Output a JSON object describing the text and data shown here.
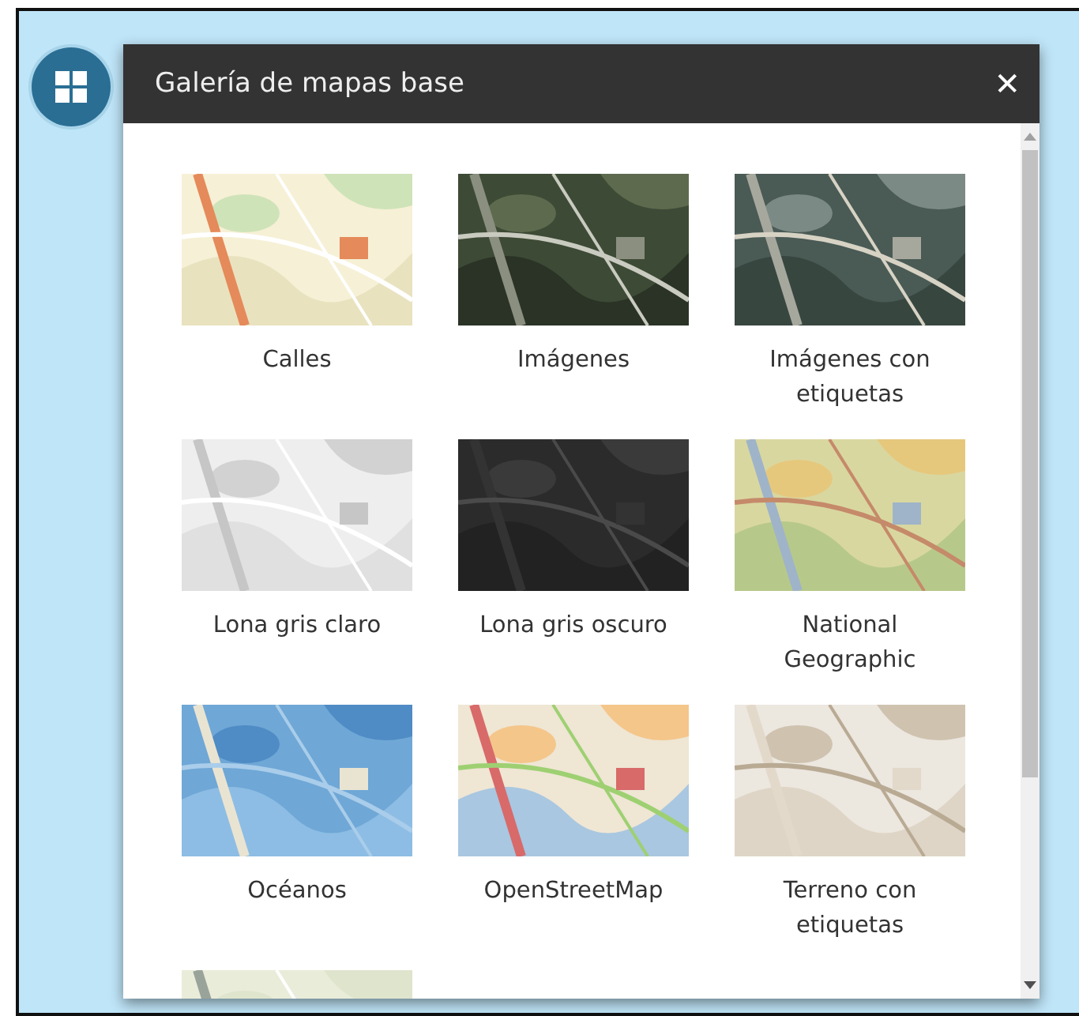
{
  "panel": {
    "title": "Galería de mapas base",
    "close": "✕"
  },
  "basemaps": [
    {
      "label": "Calles",
      "kind": "picture"
    },
    {
      "label": "Imágenes",
      "kind": "picture"
    },
    {
      "label": "Imágenes con etiquetas",
      "kind": "picture"
    },
    {
      "label": "Lona gris claro",
      "kind": "picture"
    },
    {
      "label": "Lona gris oscuro",
      "kind": "picture"
    },
    {
      "label": "National Geographic",
      "kind": "picture"
    },
    {
      "label": "Océanos",
      "kind": "picture"
    },
    {
      "label": "OpenStreetMap",
      "kind": "picture"
    },
    {
      "label": "Terreno con etiquetas",
      "kind": "picture"
    },
    {
      "kind": "picture"
    }
  ]
}
